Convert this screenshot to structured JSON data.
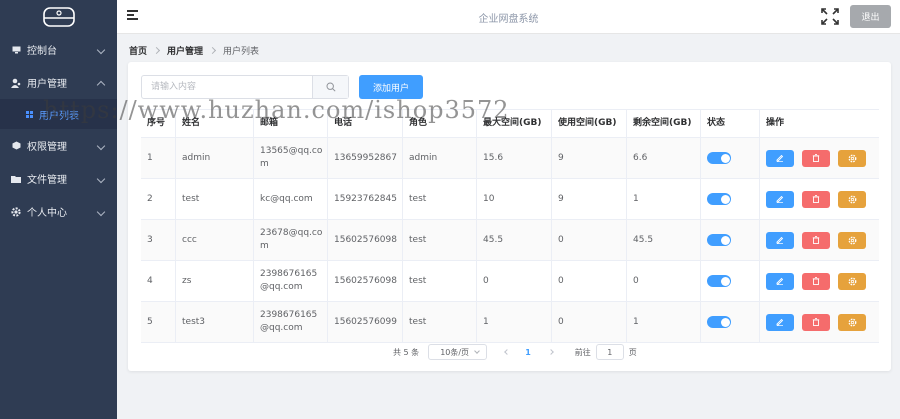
{
  "app": {
    "title": "企业网盘系统",
    "logout_label": "退出"
  },
  "sidebar": {
    "items": [
      {
        "label": "控制台",
        "icon": "monitor-icon"
      },
      {
        "label": "用户管理",
        "icon": "user-icon",
        "expanded": true
      },
      {
        "label": "权限管理",
        "icon": "cube-icon"
      },
      {
        "label": "文件管理",
        "icon": "folder-icon"
      },
      {
        "label": "个人中心",
        "icon": "gear-icon"
      }
    ],
    "sub_items": [
      {
        "label": "用户列表",
        "icon": "grid-icon"
      }
    ]
  },
  "breadcrumb": [
    "首页",
    "用户管理",
    "用户列表"
  ],
  "search": {
    "placeholder": "请输入内容",
    "value": ""
  },
  "toolbar": {
    "add_label": "添加用户"
  },
  "table": {
    "columns": [
      "序号",
      "姓名",
      "邮箱",
      "电话",
      "角色",
      "最大空间(GB)",
      "使用空间(GB)",
      "剩余空间(GB)",
      "状态",
      "操作"
    ],
    "rows": [
      {
        "id": "1",
        "name": "admin",
        "email": "13565@qq.com",
        "phone": "13659952867",
        "role": "admin",
        "max": "15.6",
        "used": "9",
        "free": "6.6",
        "status": true
      },
      {
        "id": "2",
        "name": "test",
        "email": "kc@qq.com",
        "phone": "15923762845",
        "role": "test",
        "max": "10",
        "used": "9",
        "free": "1",
        "status": true
      },
      {
        "id": "3",
        "name": "ccc",
        "email": "23678@qq.com",
        "phone": "15602576098",
        "role": "test",
        "max": "45.5",
        "used": "0",
        "free": "45.5",
        "status": true
      },
      {
        "id": "4",
        "name": "zs",
        "email": "2398676165@qq.com",
        "phone": "15602576098",
        "role": "test",
        "max": "0",
        "used": "0",
        "free": "0",
        "status": true
      },
      {
        "id": "5",
        "name": "test3",
        "email": "2398676165@qq.com",
        "phone": "15602576099",
        "role": "test",
        "max": "1",
        "used": "0",
        "free": "1",
        "status": true
      }
    ]
  },
  "pagination": {
    "total_text": "共 5 条",
    "page_size": "10条/页",
    "current": "1",
    "goto_label": "前往",
    "goto_value": "1",
    "page_unit": "页"
  },
  "watermark": "https://www.huzhan.com/ishop3572",
  "colors": {
    "sidebar": "#2f3c53",
    "primary": "#409eff",
    "danger": "#f56c6c",
    "warning": "#e6a23c",
    "logout": "#a6a9ad"
  }
}
